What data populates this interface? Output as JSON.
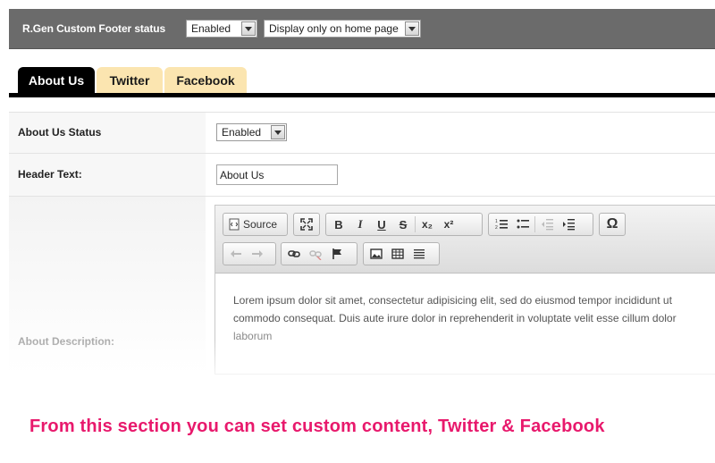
{
  "topbar": {
    "label": "R.Gen Custom Footer status",
    "status_select": "Enabled",
    "display_select": "Display only on home page"
  },
  "tabs": [
    {
      "label": "About Us",
      "active": true
    },
    {
      "label": "Twitter",
      "active": false
    },
    {
      "label": "Facebook",
      "active": false
    }
  ],
  "form": {
    "about_status_label": "About Us Status",
    "about_status_value": "Enabled",
    "header_text_label": "Header Text:",
    "header_text_value": "About Us",
    "about_description_label": "About Description:"
  },
  "editor": {
    "toolbar": {
      "source_label": "Source",
      "bold": "B",
      "italic": "I",
      "underline": "U",
      "strike": "S",
      "subscript": "x₂",
      "superscript": "x²",
      "special_char": "Ω"
    },
    "content_lines": [
      "Lorem ipsum dolor sit amet, consectetur adipisicing elit, sed do eiusmod tempor incididunt ut",
      "commodo consequat. Duis aute irure dolor in reprehenderit in voluptate velit esse cillum dolor",
      "laborum"
    ]
  },
  "caption": "From this section you can set custom content, Twitter & Facebook",
  "colors": {
    "topbar_bg": "#6b6b6b",
    "tab_active_bg": "#000000",
    "tab_inactive_bg": "#fbe5b0",
    "caption": "#e8196c"
  }
}
